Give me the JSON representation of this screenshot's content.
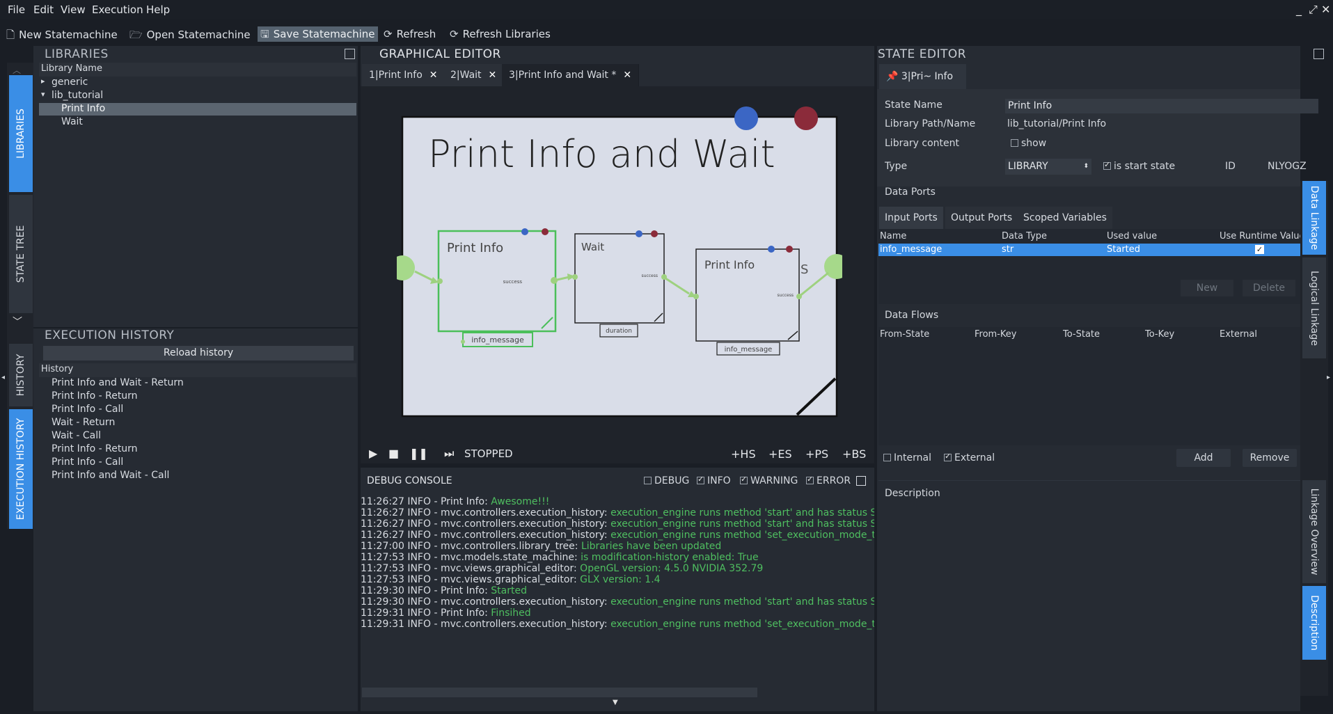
{
  "menu": [
    "File",
    "Edit",
    "View",
    "Execution",
    "Help"
  ],
  "window_controls": [
    "_",
    "⤢",
    "✕"
  ],
  "toolbar": {
    "new": "New Statemachine",
    "open": "Open Statemachine",
    "save": "Save Statemachine",
    "refresh": "Refresh",
    "refresh_libraries": "Refresh Libraries"
  },
  "left_tabs": {
    "libraries": "LIBRARIES",
    "state_tree": "STATE TREE",
    "history": "HISTORY",
    "execution_history": "EXECUTION HISTORY"
  },
  "libraries": {
    "title": "LIBRARIES",
    "header": "Library Name",
    "items": [
      {
        "label": "generic",
        "expander": "▸"
      },
      {
        "label": "lib_tutorial",
        "expander": "▾"
      },
      {
        "label": "Print Info"
      },
      {
        "label": "Wait"
      }
    ]
  },
  "execution_history": {
    "title": "EXECUTION HISTORY",
    "reload": "Reload history",
    "header": "History",
    "items": [
      "Print Info and Wait - Return",
      "Print Info - Return",
      "Print Info - Call",
      "Wait - Return",
      "Wait - Call",
      "Print Info - Return",
      "Print Info - Call",
      "Print Info and Wait - Call"
    ]
  },
  "graphical_editor": {
    "title": "GRAPHICAL EDITOR",
    "tabs": [
      "1|Print Info",
      "2|Wait",
      "3|Print Info and Wait *"
    ],
    "canvas_title": "Print  Info  and  Wait",
    "states": [
      {
        "name": "Print  Info",
        "outcome": "success",
        "port": "info_message"
      },
      {
        "name": "Wait",
        "outcome": "success",
        "port": "duration"
      },
      {
        "name": "Print  Info",
        "outcome": "success",
        "port": "info_message"
      }
    ],
    "outcome_letter": "S",
    "status": "STOPPED",
    "tools": [
      "+HS",
      "+ES",
      "+PS",
      "+BS"
    ]
  },
  "debug_console": {
    "title": "DEBUG CONSOLE",
    "filters": [
      {
        "label": "DEBUG",
        "checked": false
      },
      {
        "label": "INFO",
        "checked": true
      },
      {
        "label": "WARNING",
        "checked": true
      },
      {
        "label": "ERROR",
        "checked": true
      }
    ],
    "lines": [
      {
        "prefix": "11:26:27 INFO - Print Info: ",
        "msg": "Awesome!!!"
      },
      {
        "prefix": "11:26:27 INFO - mvc.controllers.execution_history: ",
        "msg": "execution_engine runs method 'start' and has status STOP"
      },
      {
        "prefix": "11:26:27 INFO - mvc.controllers.execution_history: ",
        "msg": "execution_engine runs method 'start' and has status STOP"
      },
      {
        "prefix": "11:26:27 INFO - mvc.controllers.execution_history: ",
        "msg": "execution_engine runs method 'set_execution_mode_to_st"
      },
      {
        "prefix": "11:27:00 INFO - mvc.controllers.library_tree: ",
        "msg": "Libraries have been updated"
      },
      {
        "prefix": "11:27:53 INFO - mvc.models.state_machine: ",
        "msg": "is modification-history enabled: True"
      },
      {
        "prefix": "11:27:53 INFO - mvc.views.graphical_editor: ",
        "msg": "OpenGL version: 4.5.0 NVIDIA 352.79"
      },
      {
        "prefix": "11:27:53 INFO - mvc.views.graphical_editor: ",
        "msg": "GLX version: 1.4"
      },
      {
        "prefix": "11:29:30 INFO - Print Info: ",
        "msg": "Started"
      },
      {
        "prefix": "11:29:30 INFO - mvc.controllers.execution_history: ",
        "msg": "execution_engine runs method 'start' and has status STAR"
      },
      {
        "prefix": "11:29:31 INFO - Print Info: ",
        "msg": "Finsihed"
      },
      {
        "prefix": "11:29:31 INFO - mvc.controllers.execution_history: ",
        "msg": "execution_engine runs method 'set_execution_mode_to_st"
      }
    ]
  },
  "state_editor": {
    "title": "STATE EDITOR",
    "tab": "3|Pri~ Info",
    "state_name_label": "State Name",
    "state_name_value": "Print Info",
    "lib_path_label": "Library Path/Name",
    "lib_path_value": "lib_tutorial/Print Info",
    "lib_content_label": "Library content",
    "lib_content_show": "show",
    "type_label": "Type",
    "type_value": "LIBRARY",
    "is_start_state": "is start state",
    "id_label": "ID",
    "id_value": "NLYOGZ",
    "data_ports_label": "Data Ports",
    "port_tabs": [
      "Input Ports",
      "Output Ports",
      "Scoped Variables"
    ],
    "port_headers": [
      "Name",
      "Data Type",
      "Used value",
      "Use Runtime Value"
    ],
    "port_rows": [
      {
        "name": "info_message",
        "type": "str",
        "value": "Started",
        "runtime": true
      }
    ],
    "new_btn": "New",
    "delete_btn": "Delete",
    "data_flows_label": "Data Flows",
    "flow_headers": [
      "From-State",
      "From-Key",
      "To-State",
      "To-Key",
      "External"
    ],
    "internal": "Internal",
    "external": "External",
    "add_btn": "Add",
    "remove_btn": "Remove",
    "description_label": "Description"
  },
  "right_tabs": [
    "Data Linkage",
    "Logical Linkage",
    "Linkage Overview",
    "Description"
  ],
  "colors": {
    "accent": "#3a8ee6",
    "green": "#4fbf60",
    "selection": "#3a8ee6"
  }
}
